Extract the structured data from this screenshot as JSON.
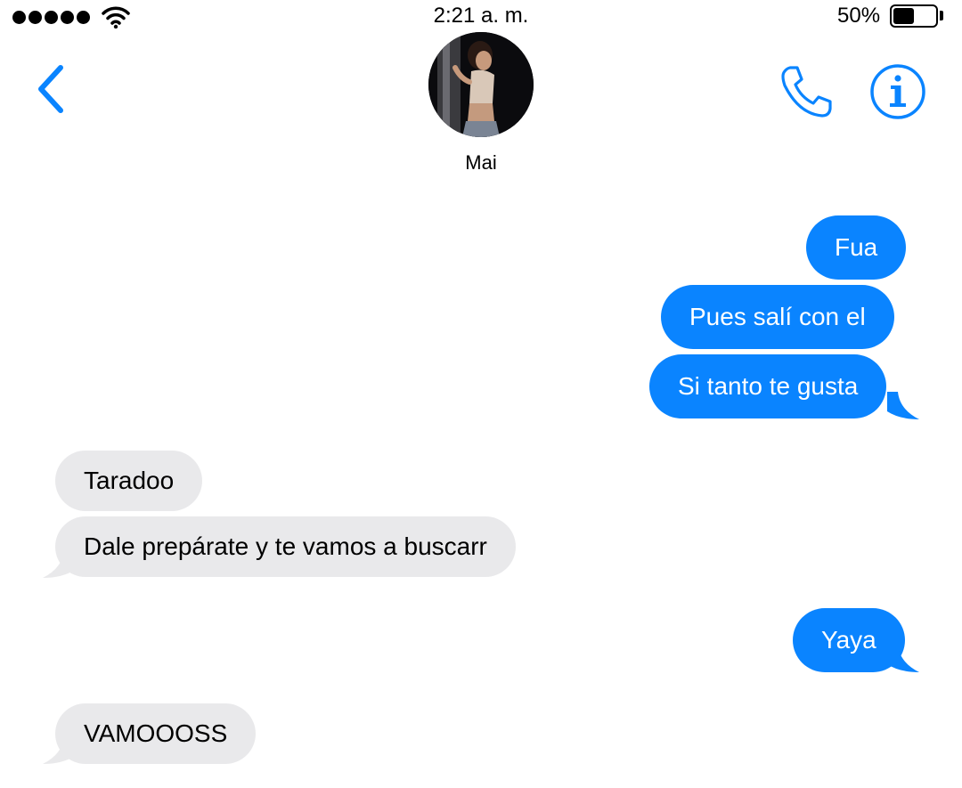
{
  "status_bar": {
    "time": "2:21 a. m.",
    "battery_percent": "50%",
    "battery_level": 0.5
  },
  "header": {
    "contact_name": "Mai",
    "back_icon": "chevron-left-icon",
    "call_icon": "phone-icon",
    "info_icon": "info-icon"
  },
  "messages": [
    {
      "direction": "outgoing",
      "text": "Fua"
    },
    {
      "direction": "outgoing",
      "text": "Pues salí con el"
    },
    {
      "direction": "outgoing",
      "text": "Si tanto te gusta"
    },
    {
      "direction": "incoming",
      "text": "Taradoo"
    },
    {
      "direction": "incoming",
      "text": "Dale prepárate y te vamos a buscarr"
    },
    {
      "direction": "outgoing",
      "text": "Yaya"
    },
    {
      "direction": "incoming",
      "text": "VAMOOOSS"
    }
  ],
  "colors": {
    "accent": "#0a84ff",
    "outgoing_bubble": "#0a84ff",
    "incoming_bubble": "#e9e9eb",
    "header_background": "#f8f8f8"
  }
}
